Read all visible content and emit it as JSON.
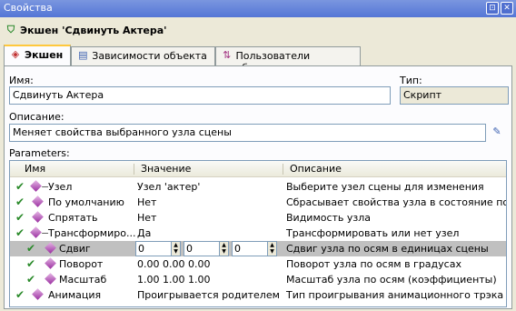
{
  "window": {
    "title": "Свойства",
    "btn_pin": "⊡",
    "btn_close": "✕"
  },
  "header": {
    "title": "Экшен 'Сдвинуть Актера'"
  },
  "tabs": [
    {
      "label": "Экшен"
    },
    {
      "label": "Зависимости объекта"
    },
    {
      "label": "Пользователи объекта"
    }
  ],
  "form": {
    "name_label": "Имя:",
    "name_value": "Сдвинуть Актера",
    "type_label": "Тип:",
    "type_value": "Скрипт",
    "desc_label": "Описание:",
    "desc_value": "Меняет свойства выбранного узла сцены",
    "params_label": "Parameters:"
  },
  "grid": {
    "columns": [
      "Имя",
      "Значение",
      "Описание"
    ],
    "rows": [
      {
        "name": "Узел",
        "value": "Узел 'актер'",
        "desc": "Выберите узел сцены для изменения",
        "expand": "−"
      },
      {
        "name": "По умолчанию",
        "value": "Нет",
        "desc": "Сбрасывает свойства узла в состояние по умол"
      },
      {
        "name": "Спрятать",
        "value": "Нет",
        "desc": "Видимость узла"
      },
      {
        "name": "Трансформиро...",
        "value": "Да",
        "desc": "Трансформировать или нет узел",
        "expand": "−"
      },
      {
        "name": "Сдвиг",
        "values": [
          "0",
          "0",
          "0"
        ],
        "desc": "Сдвиг узла по осям в единицах сцены"
      },
      {
        "name": "Поворот",
        "value": "0.00  0.00  0.00",
        "desc": "Поворот узла по осям в градусах"
      },
      {
        "name": "Масштаб",
        "value": "1.00  1.00  1.00",
        "desc": "Масштаб узла по осям (коэффициенты)"
      },
      {
        "name": "Анимация",
        "value": "Проигрывается родителем",
        "desc": "Тип проигрывания анимационного трэка"
      }
    ]
  }
}
